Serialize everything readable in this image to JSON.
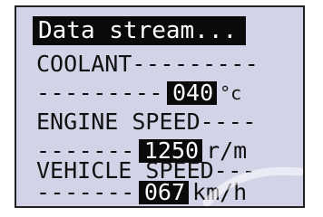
{
  "screen": {
    "title": "Data stream...",
    "items": [
      {
        "label": "COOLANT",
        "label_dashes": "---------",
        "value_dashes": "---------",
        "value": "040",
        "unit": "°c"
      },
      {
        "label": "ENGINE SPEED",
        "label_dashes": "----",
        "value_dashes": "-------",
        "value": "1250",
        "unit": "r/m"
      },
      {
        "label": "VEHICLE SPEED",
        "label_dashes": "---",
        "value_dashes": "-------",
        "value": "067",
        "unit": "km/h"
      }
    ]
  },
  "colors": {
    "screen_bg": "#d3d3e8",
    "highlight_bg": "#0a0a0a",
    "highlight_text": "#ffffff",
    "text": "#111111"
  }
}
